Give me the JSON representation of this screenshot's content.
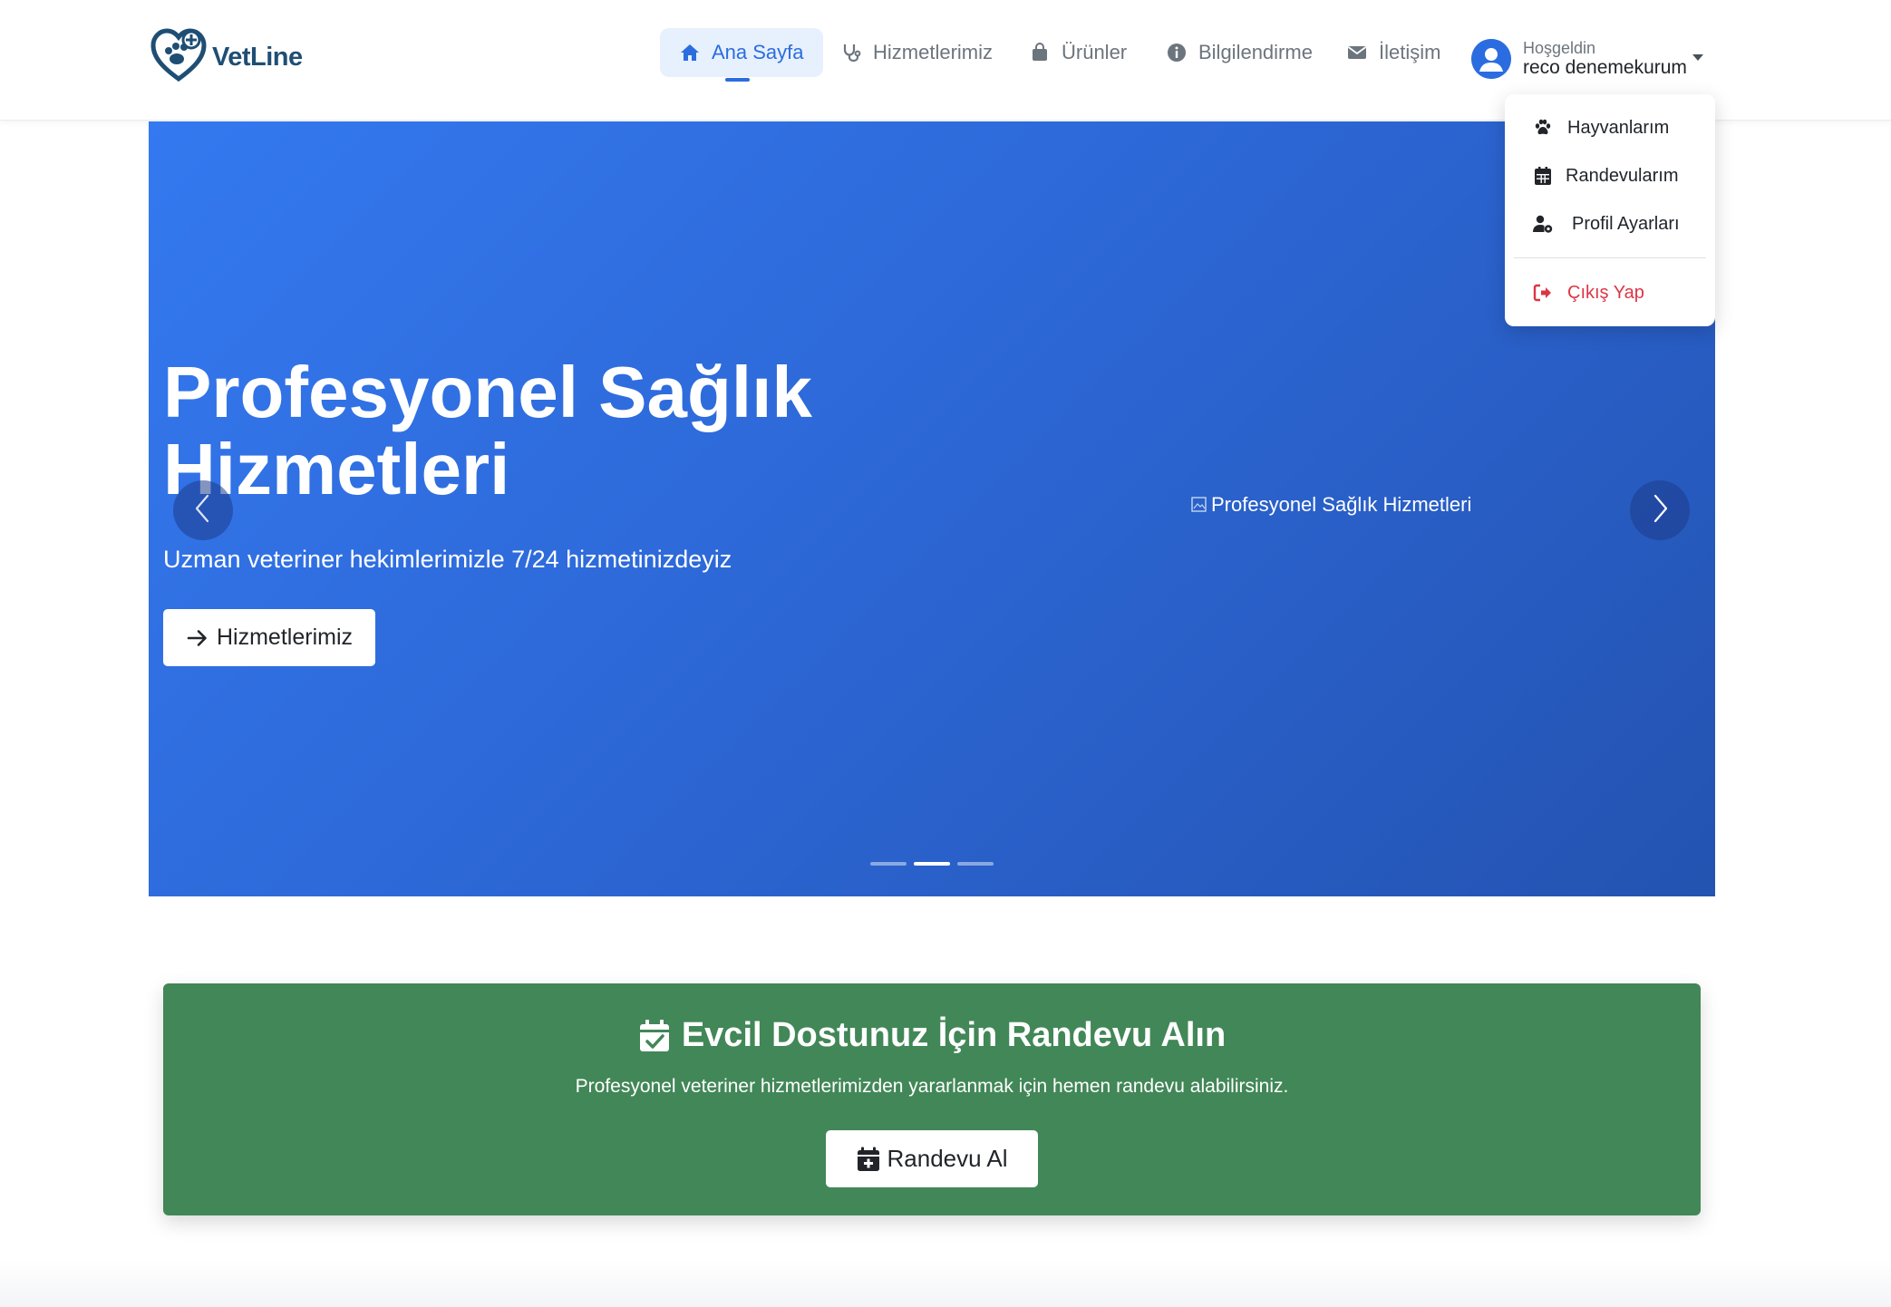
{
  "brand": {
    "name": "VetLine",
    "logo_icon": "vet-heart-paw-icon"
  },
  "nav": {
    "items": [
      {
        "label": "Ana Sayfa",
        "icon": "home-icon",
        "active": true
      },
      {
        "label": "Hizmetlerimiz",
        "icon": "stethoscope-icon",
        "active": false
      },
      {
        "label": "Ürünler",
        "icon": "shopping-bag-icon",
        "active": false
      },
      {
        "label": "Bilgilendirme",
        "icon": "info-circle-icon",
        "active": false
      },
      {
        "label": "İletişim",
        "icon": "envelope-icon",
        "active": false
      }
    ]
  },
  "user": {
    "greeting": "Hoşgeldin",
    "name": "reco denemekurum",
    "icon": "user-circle-icon"
  },
  "dropdown": {
    "items": [
      {
        "label": "Hayvanlarım",
        "icon": "paw-icon"
      },
      {
        "label": "Randevularım",
        "icon": "calendar-icon"
      },
      {
        "label": "Profil Ayarları",
        "icon": "user-cog-icon"
      }
    ],
    "logout": {
      "label": "Çıkış Yap",
      "icon": "sign-out-icon"
    }
  },
  "hero": {
    "title": "Profesyonel Sağlık Hizmetleri",
    "subtitle": "Uzman veteriner hekimlerimizle 7/24 hizmetinizdeyiz",
    "button_label": "Hizmetlerimiz",
    "image_alt": "Profesyonel Sağlık Hizmetleri",
    "slide_count": 3,
    "active_slide": 2
  },
  "appointment": {
    "title": "Evcil Dostunuz İçin Randevu Alın",
    "text": "Profesyonel veteriner hizmetlerimizden yararlanmak için hemen randevu alabilirsiniz.",
    "button_label": "Randevu Al"
  },
  "colors": {
    "primary": "#2b6de0",
    "hero_gradient_start": "#3479f0",
    "hero_gradient_end": "#2453b1",
    "appointment_bg": "#428757",
    "logout": "#dc3545"
  }
}
